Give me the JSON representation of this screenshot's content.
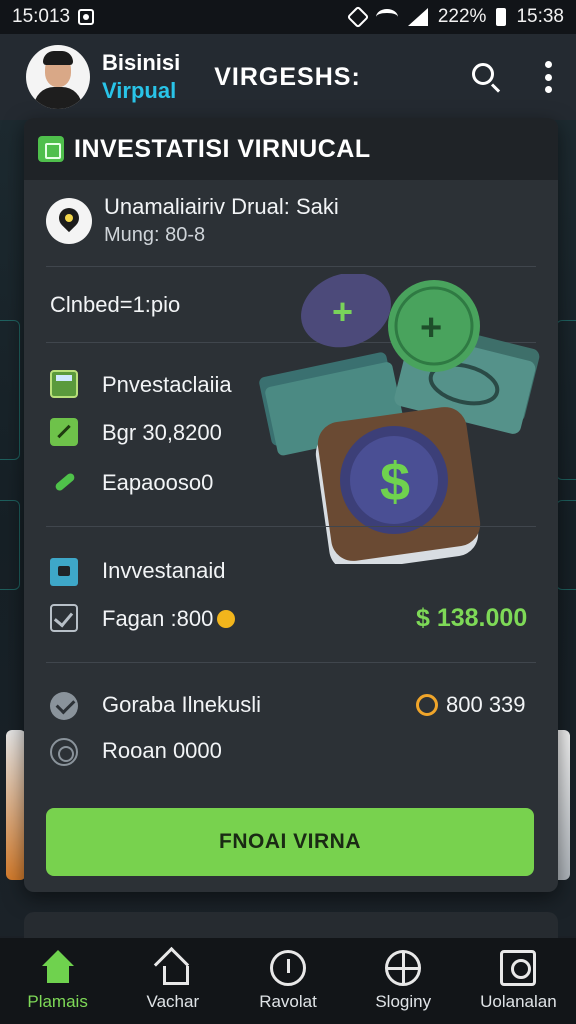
{
  "status_bar": {
    "time_left": "15:013",
    "battery": "222%",
    "time_right": "15:38"
  },
  "header": {
    "brand_line1": "Bisinisi",
    "brand_line2": "Virpual",
    "title": "VIRGESHS:",
    "search_icon": "search-icon",
    "more_icon": "more-vertical-icon"
  },
  "card": {
    "title": "INVESTATISI VIRNUCAL",
    "location": {
      "name": "Unamaliairiv Drual: Saki",
      "sub": "Mung: 80-8"
    },
    "section_label": "Clnbed=1:pio",
    "list1": [
      {
        "icon": "calculator-icon",
        "label": "Pnvestaclaiia"
      },
      {
        "icon": "chart-icon",
        "label": "Bgr 30,8200"
      },
      {
        "icon": "phone-icon",
        "label": "Eapaooso0"
      }
    ],
    "investment": {
      "title": "Invvestanaid",
      "row_label": "Fagan :800",
      "amount": "$ 138.000"
    },
    "summary": {
      "title": "Goraba Ilnekusli",
      "value": "800 339",
      "row_label": "Rooan 0000"
    },
    "cta_label": "FNOAI VIRNA"
  },
  "bottom_nav": [
    {
      "icon": "home-icon",
      "label": "Plamais",
      "active": true
    },
    {
      "icon": "house-outline-icon",
      "label": "Vachar",
      "active": false
    },
    {
      "icon": "clock-icon",
      "label": "Ravolat",
      "active": false
    },
    {
      "icon": "target-icon",
      "label": "Sloginy",
      "active": false
    },
    {
      "icon": "profile-icon",
      "label": "Uolanalan",
      "active": false
    }
  ],
  "colors": {
    "accent_green": "#78d24e",
    "brand_blue": "#29c4e8",
    "background": "#1b2026",
    "card": "#2c3136"
  }
}
